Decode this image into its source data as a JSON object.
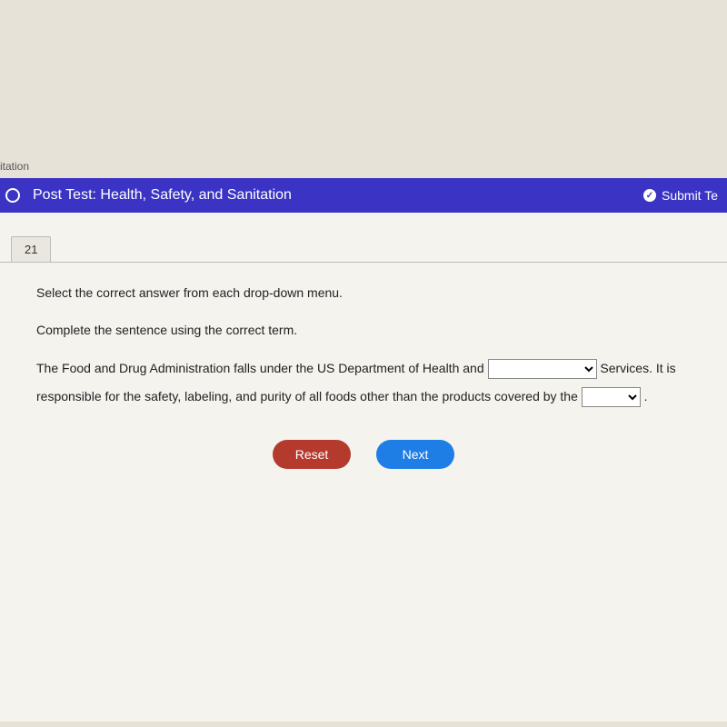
{
  "breadcrumb": {
    "text": "itation"
  },
  "header": {
    "title": "Post Test: Health, Safety, and Sanitation",
    "submit_label": "Submit Te"
  },
  "question": {
    "number": "21",
    "instruction1": "Select the correct answer from each drop-down menu.",
    "instruction2": "Complete the sentence using the correct term.",
    "part1": "The Food and Drug Administration falls under the US Department of Health and ",
    "part2": " Services. It is responsible for the safety, labeling, and purity of all foods other than the products covered by the ",
    "part3": " .",
    "blank1_selected": "",
    "blank2_selected": ""
  },
  "buttons": {
    "reset": "Reset",
    "next": "Next"
  }
}
